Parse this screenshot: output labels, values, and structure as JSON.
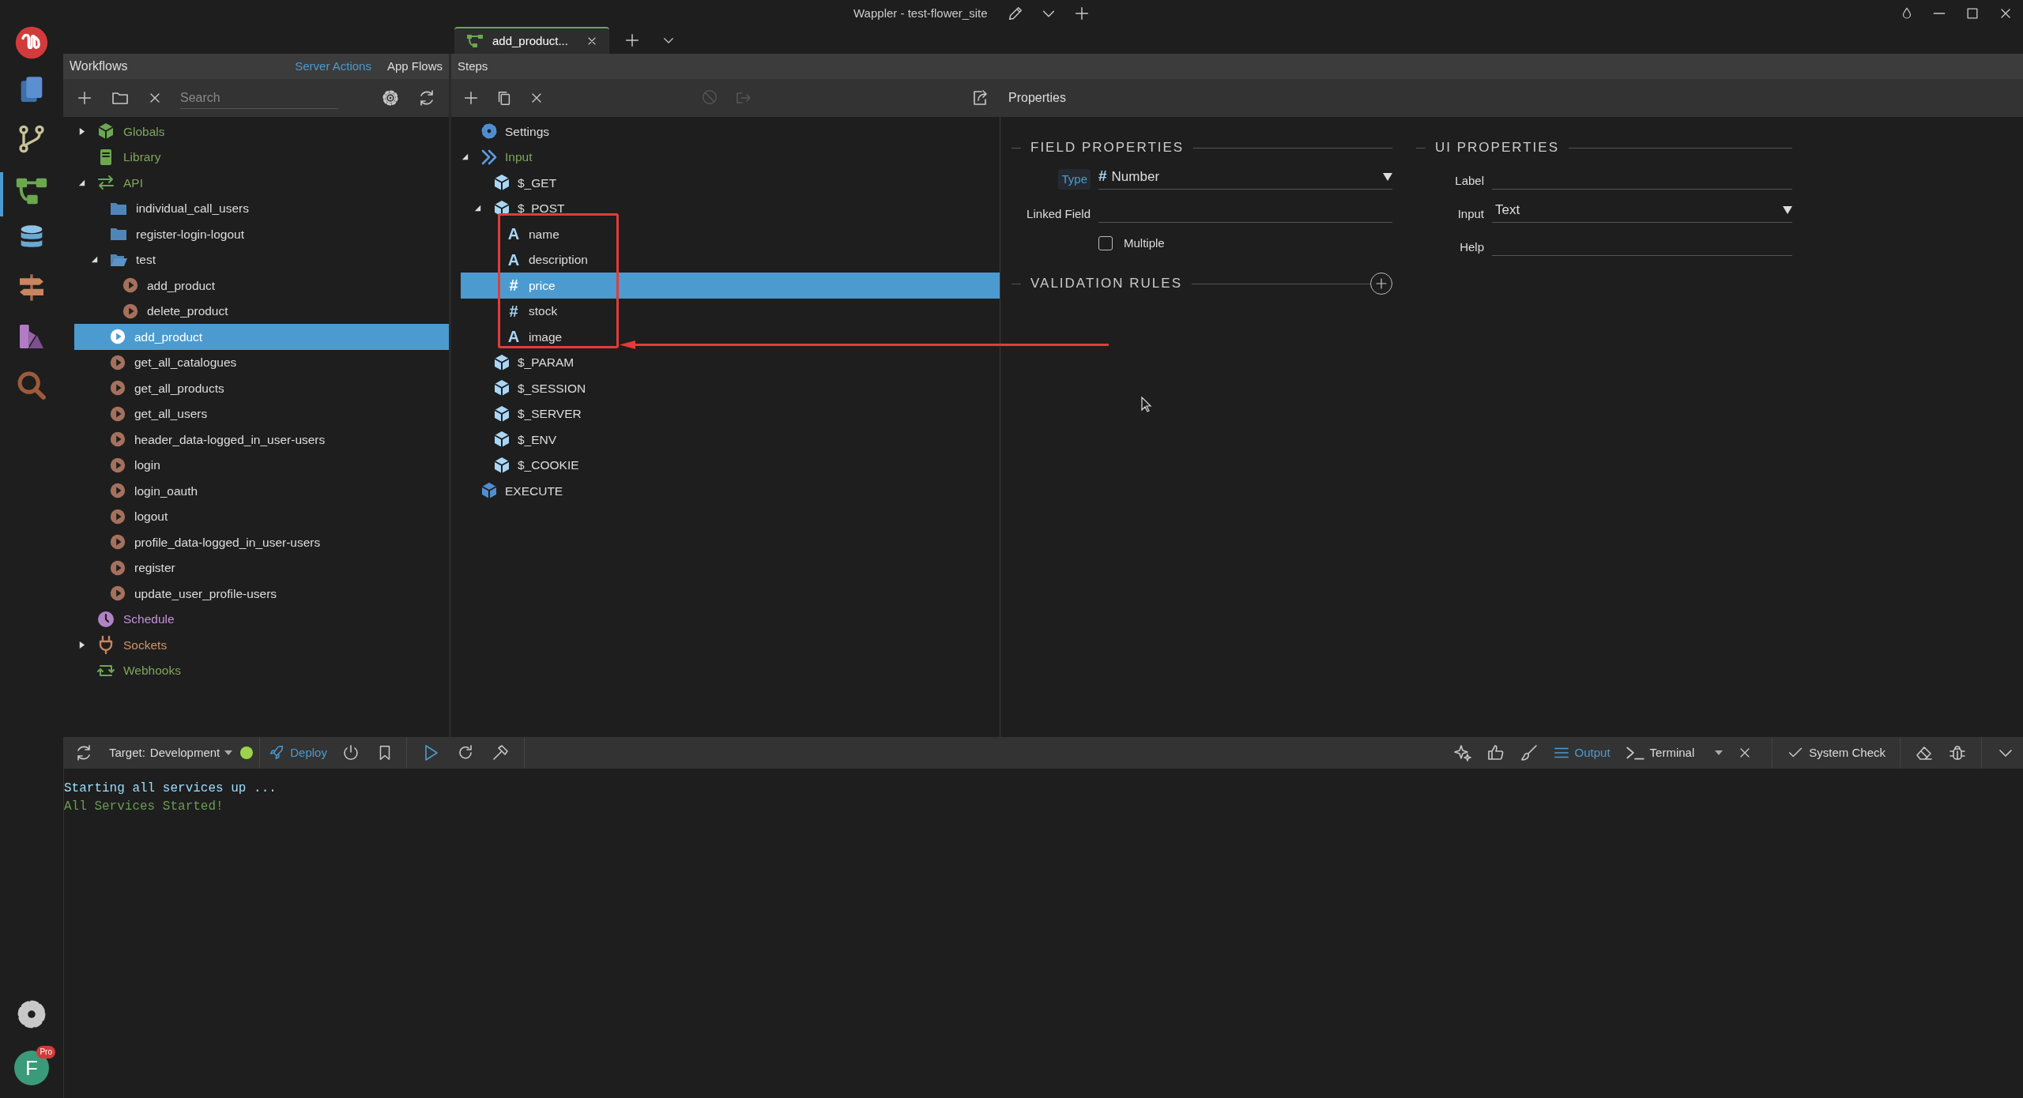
{
  "title_bar": {
    "title": "Wappler - test-flower_site"
  },
  "tabs": [
    {
      "label": "add_product...",
      "selected": true
    }
  ],
  "activity_bar": {
    "avatar": {
      "initial": "F",
      "badge": "Pro"
    }
  },
  "workflows": {
    "title": "Workflows",
    "modes": [
      {
        "label": "Server Actions",
        "selected": true
      },
      {
        "label": "App Flows",
        "selected": false
      }
    ],
    "search": {
      "placeholder": "Search"
    },
    "tree": [
      {
        "label": "Globals",
        "kind": "globals",
        "expanded": false,
        "selected": false
      },
      {
        "label": "Library",
        "kind": "library",
        "selected": false
      },
      {
        "label": "API",
        "kind": "api",
        "expanded": true,
        "selected": false,
        "children": [
          {
            "label": "individual_call_users",
            "kind": "folder",
            "selected": false
          },
          {
            "label": "register-login-logout",
            "kind": "folder",
            "selected": false
          },
          {
            "label": "test",
            "kind": "folder",
            "expanded": true,
            "selected": false,
            "children": [
              {
                "label": "add_product",
                "kind": "action",
                "selected": false
              },
              {
                "label": "delete_product",
                "kind": "action",
                "selected": false
              }
            ]
          },
          {
            "label": "add_product",
            "kind": "action",
            "selected": true
          },
          {
            "label": "get_all_catalogues",
            "kind": "action",
            "selected": false
          },
          {
            "label": "get_all_products",
            "kind": "action",
            "selected": false
          },
          {
            "label": "get_all_users",
            "kind": "action",
            "selected": false
          },
          {
            "label": "header_data-logged_in_user-users",
            "kind": "action",
            "selected": false
          },
          {
            "label": "login",
            "kind": "action",
            "selected": false
          },
          {
            "label": "login_oauth",
            "kind": "action",
            "selected": false
          },
          {
            "label": "logout",
            "kind": "action",
            "selected": false
          },
          {
            "label": "profile_data-logged_in_user-users",
            "kind": "action",
            "selected": false
          },
          {
            "label": "register",
            "kind": "action",
            "selected": false
          },
          {
            "label": "update_user_profile-users",
            "kind": "action",
            "selected": false
          }
        ]
      },
      {
        "label": "Schedule",
        "kind": "schedule",
        "selected": false
      },
      {
        "label": "Sockets",
        "kind": "sockets",
        "expanded": false,
        "selected": false
      },
      {
        "label": "Webhooks",
        "kind": "webhooks",
        "selected": false
      }
    ]
  },
  "steps": {
    "title": "Steps",
    "tree": [
      {
        "label": "Settings",
        "kind": "settings",
        "selected": false
      },
      {
        "label": "Input",
        "kind": "input",
        "expanded": true,
        "selected": false,
        "children": [
          {
            "label": "$_GET",
            "kind": "object",
            "selected": false
          },
          {
            "label": "$_POST",
            "kind": "object",
            "expanded": true,
            "selected": false,
            "children": [
              {
                "label": "name",
                "kind": "field",
                "icon": "A",
                "selected": false
              },
              {
                "label": "description",
                "kind": "field",
                "icon": "A",
                "selected": false
              },
              {
                "label": "price",
                "kind": "field",
                "icon": "#",
                "selected": true
              },
              {
                "label": "stock",
                "kind": "field",
                "icon": "#",
                "selected": false
              },
              {
                "label": "image",
                "kind": "field",
                "icon": "A",
                "selected": false
              }
            ]
          },
          {
            "label": "$_PARAM",
            "kind": "object",
            "selected": false
          },
          {
            "label": "$_SESSION",
            "kind": "object",
            "selected": false
          },
          {
            "label": "$_SERVER",
            "kind": "object",
            "selected": false
          },
          {
            "label": "$_ENV",
            "kind": "object",
            "selected": false
          },
          {
            "label": "$_COOKIE",
            "kind": "object",
            "selected": false
          }
        ]
      },
      {
        "label": "EXECUTE",
        "kind": "execute",
        "selected": false
      }
    ]
  },
  "properties": {
    "title": "Properties",
    "field_properties": {
      "title": "FIELD PROPERTIES",
      "type": {
        "label": "Type",
        "icon": "#",
        "value": "Number"
      },
      "linked_field": {
        "label": "Linked Field"
      },
      "multiple": {
        "label": "Multiple",
        "checked": false
      }
    },
    "validation_rules": {
      "title": "VALIDATION RULES"
    },
    "ui_properties": {
      "title": "UI PROPERTIES",
      "label": {
        "label": "Label"
      },
      "input": {
        "label": "Input",
        "value": "Text"
      },
      "help": {
        "label": "Help"
      }
    }
  },
  "bottom_bar": {
    "target": {
      "label": "Target:",
      "value": "Development",
      "online": true
    },
    "deploy": "Deploy",
    "panels": [
      {
        "label": "Output",
        "selected": true
      },
      {
        "label": "Terminal",
        "selected": false
      }
    ],
    "system_check": "System Check"
  },
  "console": [
    {
      "text": "Starting all services up ...",
      "kind": "info"
    },
    {
      "text": "All Services Started!",
      "kind": "success"
    }
  ]
}
